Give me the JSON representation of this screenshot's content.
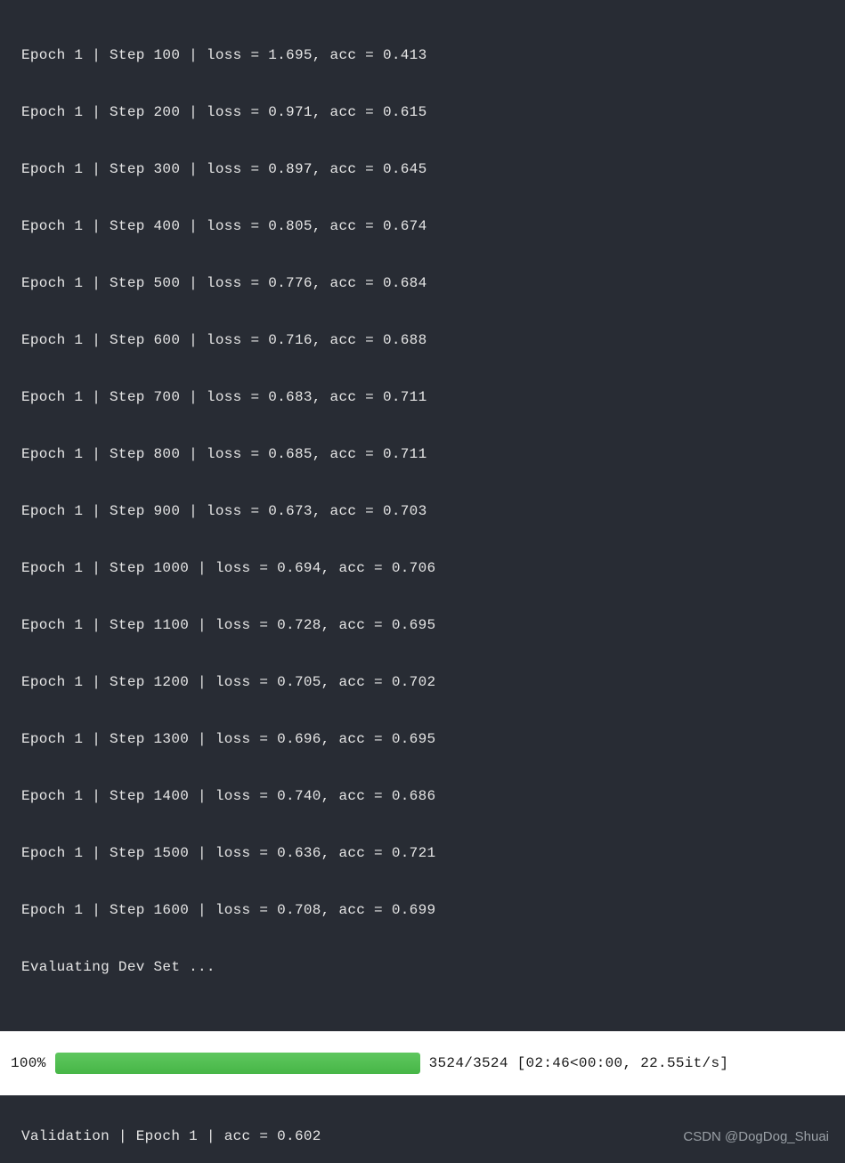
{
  "training_log": {
    "lines": [
      "Epoch 1 | Step 100 | loss = 1.695, acc = 0.413",
      "Epoch 1 | Step 200 | loss = 0.971, acc = 0.615",
      "Epoch 1 | Step 300 | loss = 0.897, acc = 0.645",
      "Epoch 1 | Step 400 | loss = 0.805, acc = 0.674",
      "Epoch 1 | Step 500 | loss = 0.776, acc = 0.684",
      "Epoch 1 | Step 600 | loss = 0.716, acc = 0.688",
      "Epoch 1 | Step 700 | loss = 0.683, acc = 0.711",
      "Epoch 1 | Step 800 | loss = 0.685, acc = 0.711",
      "Epoch 1 | Step 900 | loss = 0.673, acc = 0.703",
      "Epoch 1 | Step 1000 | loss = 0.694, acc = 0.706",
      "Epoch 1 | Step 1100 | loss = 0.728, acc = 0.695",
      "Epoch 1 | Step 1200 | loss = 0.705, acc = 0.702",
      "Epoch 1 | Step 1300 | loss = 0.696, acc = 0.695",
      "Epoch 1 | Step 1400 | loss = 0.740, acc = 0.686",
      "Epoch 1 | Step 1500 | loss = 0.636, acc = 0.721",
      "Epoch 1 | Step 1600 | loss = 0.708, acc = 0.699",
      "Evaluating Dev Set ..."
    ]
  },
  "progress": {
    "percent_label": "100%",
    "percent_value": 100,
    "stats": "3524/3524 [02:46<00:00, 22.55it/s]"
  },
  "validation": {
    "text": "Validation | Epoch 1 | acc = 0.602"
  },
  "watermark": "CSDN @DogDog_Shuai"
}
